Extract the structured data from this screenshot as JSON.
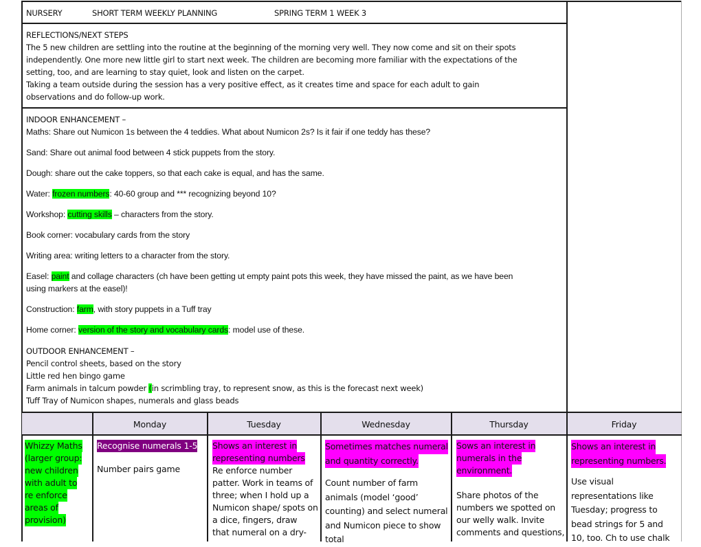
{
  "header": {
    "nursery": "NURSERY",
    "title": "SHORT TERM WEEKLY PLANNING",
    "term": "SPRING TERM 1  WEEK 3"
  },
  "reflections": {
    "heading": "REFLECTIONS/NEXT STEPS",
    "lines": [
      "The 5 new children are settling into the routine at the beginning of the morning very well. They now come and sit on their spots",
      "independently. One more new little girl to start next week. The children are becoming more familiar with the expectations of the",
      "setting, too, and are learning to stay quiet, look and listen on the carpet.",
      "Taking a team outside during the session has a very positive effect, as it creates time and space for each adult to gain",
      "observations and do follow-up work."
    ]
  },
  "indoor": {
    "heading": "INDOOR ENHANCEMENT –",
    "maths": "Maths: Share out Numicon 1s between the 4 teddies. What about Numicon 2s? Is it fair if one teddy has these?",
    "sand": "Sand: Share out animal food between 4 stick puppets from the story.",
    "dough": "Dough: share out the cake toppers, so that each cake is equal, and has the same.",
    "water": {
      "prefix": "Water: ",
      "highlight": "frozen numbers",
      "suffix": ": 40-60 group and *** recognizing beyond 10?"
    },
    "workshop": {
      "prefix": "Workshop: ",
      "highlight": "cutting skills",
      "suffix": " – characters from the story."
    },
    "book_corner": "Book corner: vocabulary cards from the story",
    "writing_area": "Writing area: writing letters to a character from the story.",
    "easel": {
      "prefix": "Easel: ",
      "highlight": "paint",
      "suffix": " and collage characters (ch have been getting ut empty paint pots this week, they have missed the paint, as we have been",
      "line2": "using markers at the easel)!"
    },
    "construction": {
      "prefix": "Construction: ",
      "highlight": "farm",
      "suffix": ", with story puppets in a Tuff tray"
    },
    "home_corner": {
      "prefix": "Home corner: ",
      "highlight": "version of the story and vocabulary cards",
      "suffix": ": model use of these."
    }
  },
  "outdoor": {
    "heading": "OUTDOOR ENHANCEMENT –",
    "line1": "Pencil control sheets, based on the story",
    "line2": "Little red hen bingo game",
    "line3": {
      "prefix": "Farm animals in talcum powder ",
      "highlight": "(",
      "suffix": "in scrimbling tray, to represent snow, as this is the forecast next week)"
    },
    "line4": "Tuff Tray of Numicon shapes, numerals and glass beads"
  },
  "days": [
    "Monday",
    "Tuesday",
    "Wednesday",
    "Thursday",
    "Friday"
  ],
  "group": {
    "lines": [
      "Whizzy Maths",
      "(larger group:",
      "new children",
      "with adult to",
      "re enforce",
      "areas of",
      "provision)"
    ]
  },
  "monday": {
    "objective": "Recognise numerals 1-5",
    "activity": "Number pairs game"
  },
  "tuesday": {
    "objective_lines": [
      "Shows an interest in",
      "representing numbers"
    ],
    "activity_lines": [
      "Re enforce number",
      "patter. Work in teams of",
      "three; when I hold up a",
      "Numicon shape/ spots on",
      "a dice, fingers, draw",
      "that numeral on a dry-"
    ]
  },
  "wednesday": {
    "objective_lines": [
      "Sometimes matches numeral",
      "and quantity correctly."
    ],
    "activity_lines": [
      "Count number of farm",
      "animals (model ‘good’",
      "counting) and select numeral",
      "and Numicon piece to show",
      "total"
    ]
  },
  "thursday": {
    "objective_lines": [
      "Sows an interest in",
      "numerals in the",
      "environment."
    ],
    "activity_lines": [
      "Share photos of the",
      "numbers we spotted on",
      "our welly walk. Invite",
      "comments and questions,"
    ]
  },
  "friday": {
    "objective_lines": [
      "Shows an interest in",
      "representing numbers."
    ],
    "activity_lines": [
      "Use visual",
      "representations like",
      "Tuesday; progress to",
      "bead strings for 5 and",
      "10, too. Ch to use chalk"
    ]
  },
  "colors": {
    "green_highlight": "#00ff00",
    "pink_highlight": "#ff00ff",
    "purple_highlight": "#800080",
    "day_header_bg": "#e4dfec"
  }
}
